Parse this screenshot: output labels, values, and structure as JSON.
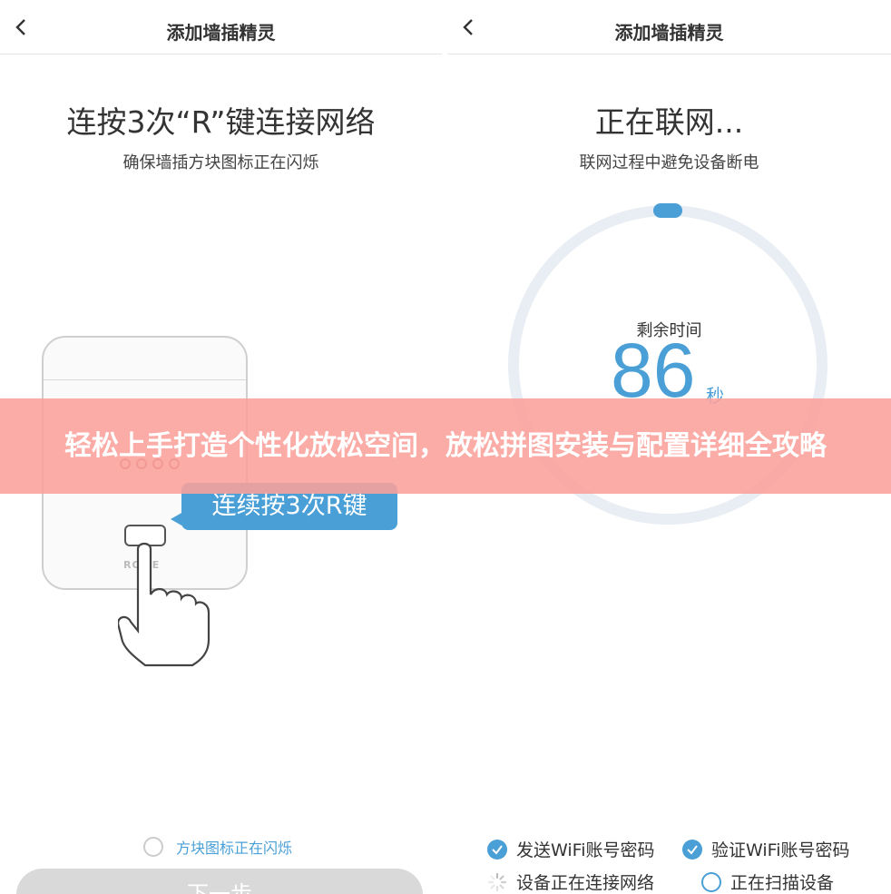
{
  "left_screen": {
    "nav_title": "添加墙插精灵",
    "title": "连按3次“R”键连接网络",
    "subtitle": "确保墙插方块图标正在闪烁",
    "device_brand": "ROME",
    "bubble_text": "连续按3次R键",
    "checkbox_label": "方块图标正在闪烁",
    "next_button": "下一步"
  },
  "right_screen": {
    "nav_title": "添加墙插精灵",
    "title": "正在联网...",
    "subtitle": "联网过程中避免设备断电",
    "remaining_label": "剩余时间",
    "remaining_seconds": "86",
    "remaining_unit": "秒",
    "steps": [
      {
        "label": "发送WiFi账号密码",
        "state": "done"
      },
      {
        "label": "验证WiFi账号密码",
        "state": "done"
      },
      {
        "label": "设备正在连接网络",
        "state": "loading"
      },
      {
        "label": "正在扫描设备",
        "state": "pending"
      }
    ]
  },
  "banner": {
    "text": "轻松上手打造个性化放松空间，放松拼图安装与配置详细全攻略"
  },
  "colors": {
    "accent": "#4a9fd6",
    "ring_track": "#e9eef4",
    "banner": "#faa09b"
  }
}
